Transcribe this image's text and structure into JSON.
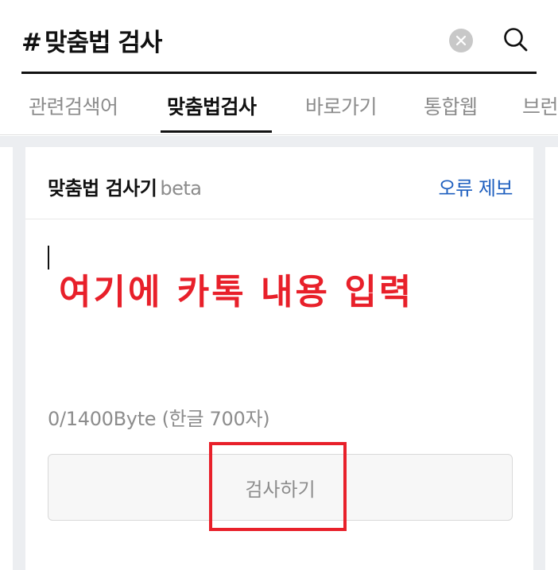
{
  "search": {
    "hash": "#",
    "query": "맞춤법 검사",
    "clear_icon": "close-icon",
    "search_icon": "search-icon"
  },
  "tabs": [
    {
      "label": "관련검색어",
      "active": false
    },
    {
      "label": "맞춤법검사",
      "active": true
    },
    {
      "label": "바로가기",
      "active": false
    },
    {
      "label": "통합웹",
      "active": false
    },
    {
      "label": "브런",
      "active": false
    }
  ],
  "checker": {
    "title": "맞춤법 검사기",
    "beta": "beta",
    "report_label": "오류 제보",
    "input_value": "",
    "overlay_note": "여기에 카톡 내용 입력",
    "byte_counter": "0/1400Byte (한글 700자)",
    "check_button_label": "검사하기"
  },
  "colors": {
    "accent_link": "#1e5fbf",
    "annotation_red": "#e8202a"
  }
}
